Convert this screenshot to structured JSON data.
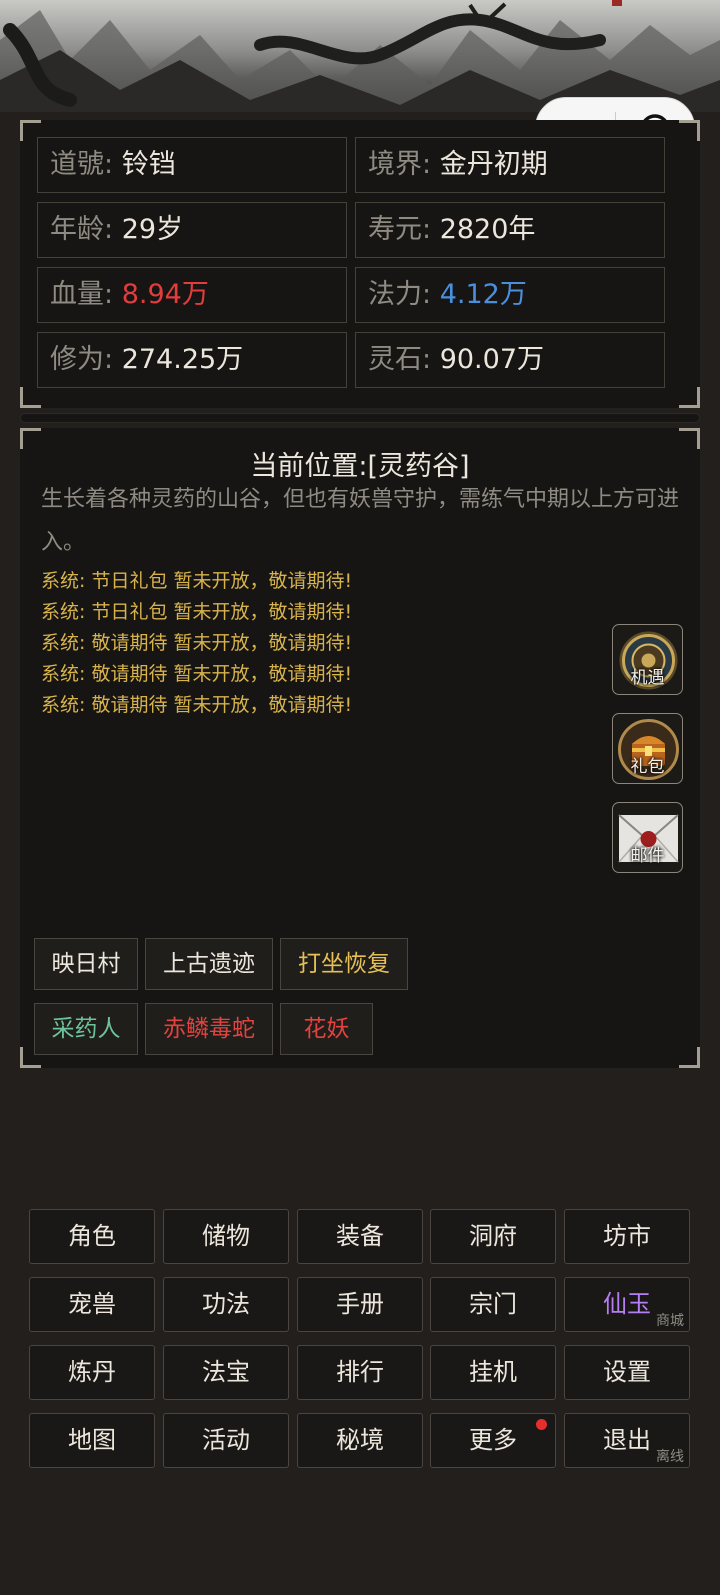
{
  "stats": [
    {
      "label": "道號:",
      "value": "铃铛",
      "color": "normal"
    },
    {
      "label": "境界:",
      "value": "金丹初期",
      "color": "normal"
    },
    {
      "label": "年龄:",
      "value": "29岁",
      "color": "normal"
    },
    {
      "label": "寿元:",
      "value": "2820年",
      "color": "normal"
    },
    {
      "label": "血量:",
      "value": "8.94万",
      "color": "#e23c3c"
    },
    {
      "label": "法力:",
      "value": "4.12万",
      "color": "#4a8fdc"
    },
    {
      "label": "修为:",
      "value": "274.25万",
      "color": "normal"
    },
    {
      "label": "灵石:",
      "value": "90.07万",
      "color": "normal"
    }
  ],
  "location": {
    "title": "当前位置:[灵药谷]",
    "description": "生长着各种灵药的山谷，但也有妖兽守护，需练气中期以上方可进入。"
  },
  "messages": [
    "系统: 节日礼包 暂未开放，敬请期待!",
    "系统: 节日礼包 暂未开放，敬请期待!",
    "系统: 敬请期待 暂未开放，敬请期待!",
    "系统: 敬请期待 暂未开放，敬请期待!",
    "系统: 敬请期待 暂未开放，敬请期待!"
  ],
  "side_buttons": [
    {
      "label": "机遇",
      "icon": "fortune-medallion-icon"
    },
    {
      "label": "礼包",
      "icon": "treasure-chest-icon"
    },
    {
      "label": "邮件",
      "icon": "envelope-icon"
    }
  ],
  "area_actions": {
    "travel": [
      "映日村",
      "上古遗迹"
    ],
    "rest": "打坐恢复",
    "npc": "采药人",
    "monsters": [
      "赤鳞毒蛇",
      "花妖"
    ]
  },
  "menu": {
    "row1": [
      "角色",
      "储物",
      "装备",
      "洞府",
      "坊市"
    ],
    "row2": [
      "宠兽",
      "功法",
      "手册",
      "宗门",
      "仙玉"
    ],
    "row3": [
      "炼丹",
      "法宝",
      "排行",
      "挂机",
      "设置"
    ],
    "row4": [
      "地图",
      "活动",
      "秘境",
      "更多",
      "退出"
    ],
    "shop_sub": "商城",
    "exit_sub": "离线"
  },
  "colors": {
    "hp": "#e23c3c",
    "mp": "#4a8fdc",
    "system_message": "#d8b34c",
    "npc": "#6dc39a",
    "monster": "#e2433f",
    "rest": "#e6c056",
    "jade": "#b57ef5",
    "notification_dot": "#e52e2e"
  },
  "mini_program_capsule": {
    "more_icon": "more-dots-icon",
    "close_icon": "target-close-icon"
  }
}
